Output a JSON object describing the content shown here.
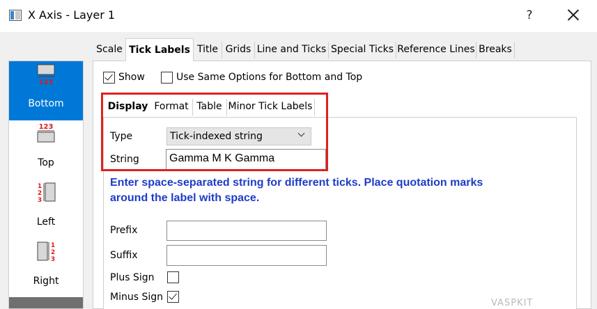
{
  "window": {
    "title": "X Axis - Layer 1",
    "help_label": "?"
  },
  "side": {
    "items": [
      {
        "label": "Bottom",
        "glyph": "123"
      },
      {
        "label": "Top",
        "glyph": "123"
      },
      {
        "label": "Left",
        "glyph_digits": [
          "1",
          "2",
          "3"
        ]
      },
      {
        "label": "Right",
        "glyph_digits": [
          "1",
          "2",
          "3"
        ]
      }
    ]
  },
  "tabs": [
    "Scale",
    "Tick Labels",
    "Title",
    "Grids",
    "Line and Ticks",
    "Special Ticks",
    "Reference Lines",
    "Breaks"
  ],
  "options": {
    "show_label": "Show",
    "show_checked": true,
    "same_options_label": "Use Same Options for Bottom and Top",
    "same_options_checked": false
  },
  "inner_tabs": [
    "Display",
    "Format",
    "Table",
    "Minor Tick Labels"
  ],
  "form": {
    "type_label": "Type",
    "type_value": "Tick-indexed string",
    "string_label": "String",
    "string_value": "Gamma M K Gamma",
    "hint_line1": "Enter space-separated string for different ticks. Place quotation marks",
    "hint_line2": "around the label with space.",
    "prefix_label": "Prefix",
    "prefix_value": "",
    "suffix_label": "Suffix",
    "suffix_value": "",
    "plus_sign_label": "Plus Sign",
    "plus_sign_checked": false,
    "minus_sign_label": "Minus Sign",
    "minus_sign_checked": true
  },
  "watermark": "VASPKIT",
  "colors": {
    "selection": "#0078d7",
    "highlight_box": "#e02020",
    "hint_text": "#1f3cc7"
  }
}
